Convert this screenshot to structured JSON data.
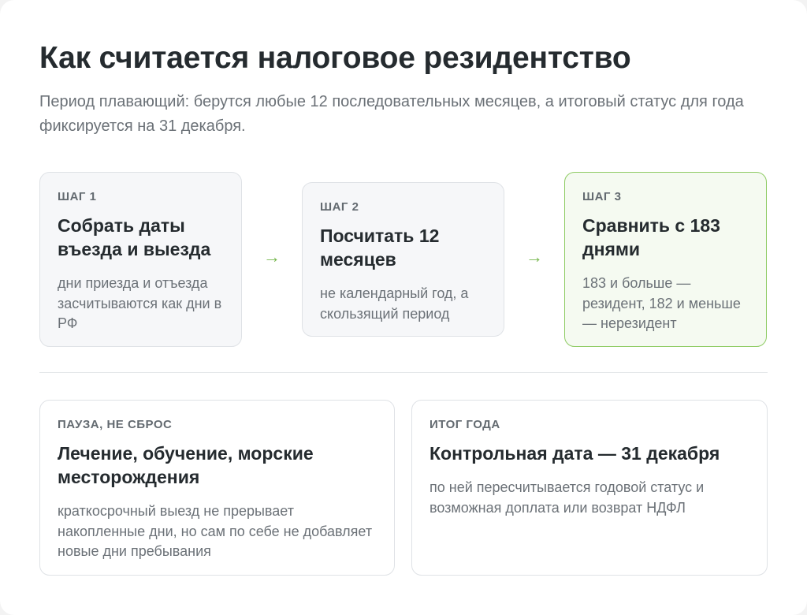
{
  "header": {
    "title": "Как считается налоговое резидентство",
    "subtitle": "Период плавающий: берутся любые 12 последовательных месяцев, а итоговый статус для года фиксируется на 31 декабря."
  },
  "steps": [
    {
      "kicker": "ШАГ 1",
      "title": "Собрать даты въезда и выезда",
      "text": "дни приезда и отъезда засчитываются как дни в РФ"
    },
    {
      "kicker": "ШАГ 2",
      "title": "Посчитать 12 месяцев",
      "text": "не календарный год, а скользящий период"
    },
    {
      "kicker": "ШАГ 3",
      "title": "Сравнить с 183 днями",
      "text": "183 и больше — резидент, 182 и меньше — нерезидент"
    }
  ],
  "arrow_glyph": "→",
  "bottom_cards": [
    {
      "kicker": "ПАУЗА, НЕ СБРОС",
      "title": "Лечение, обучение, морские месторождения",
      "text": "краткосрочный выезд не прерывает накопленные дни, но сам по себе не добавляет новые дни пребывания"
    },
    {
      "kicker": "ИТОГ ГОДА",
      "title": "Контрольная дата — 31 декабря",
      "text": "по ней пересчитывается годовой статус и возможная доплата или возврат НДФЛ"
    }
  ],
  "colors": {
    "background": "#ffffff",
    "step_border": "#dfe2e6",
    "highlight_border": "#8ecb63",
    "highlight_background": "#f5faf1",
    "arrow": "#78b84f"
  }
}
